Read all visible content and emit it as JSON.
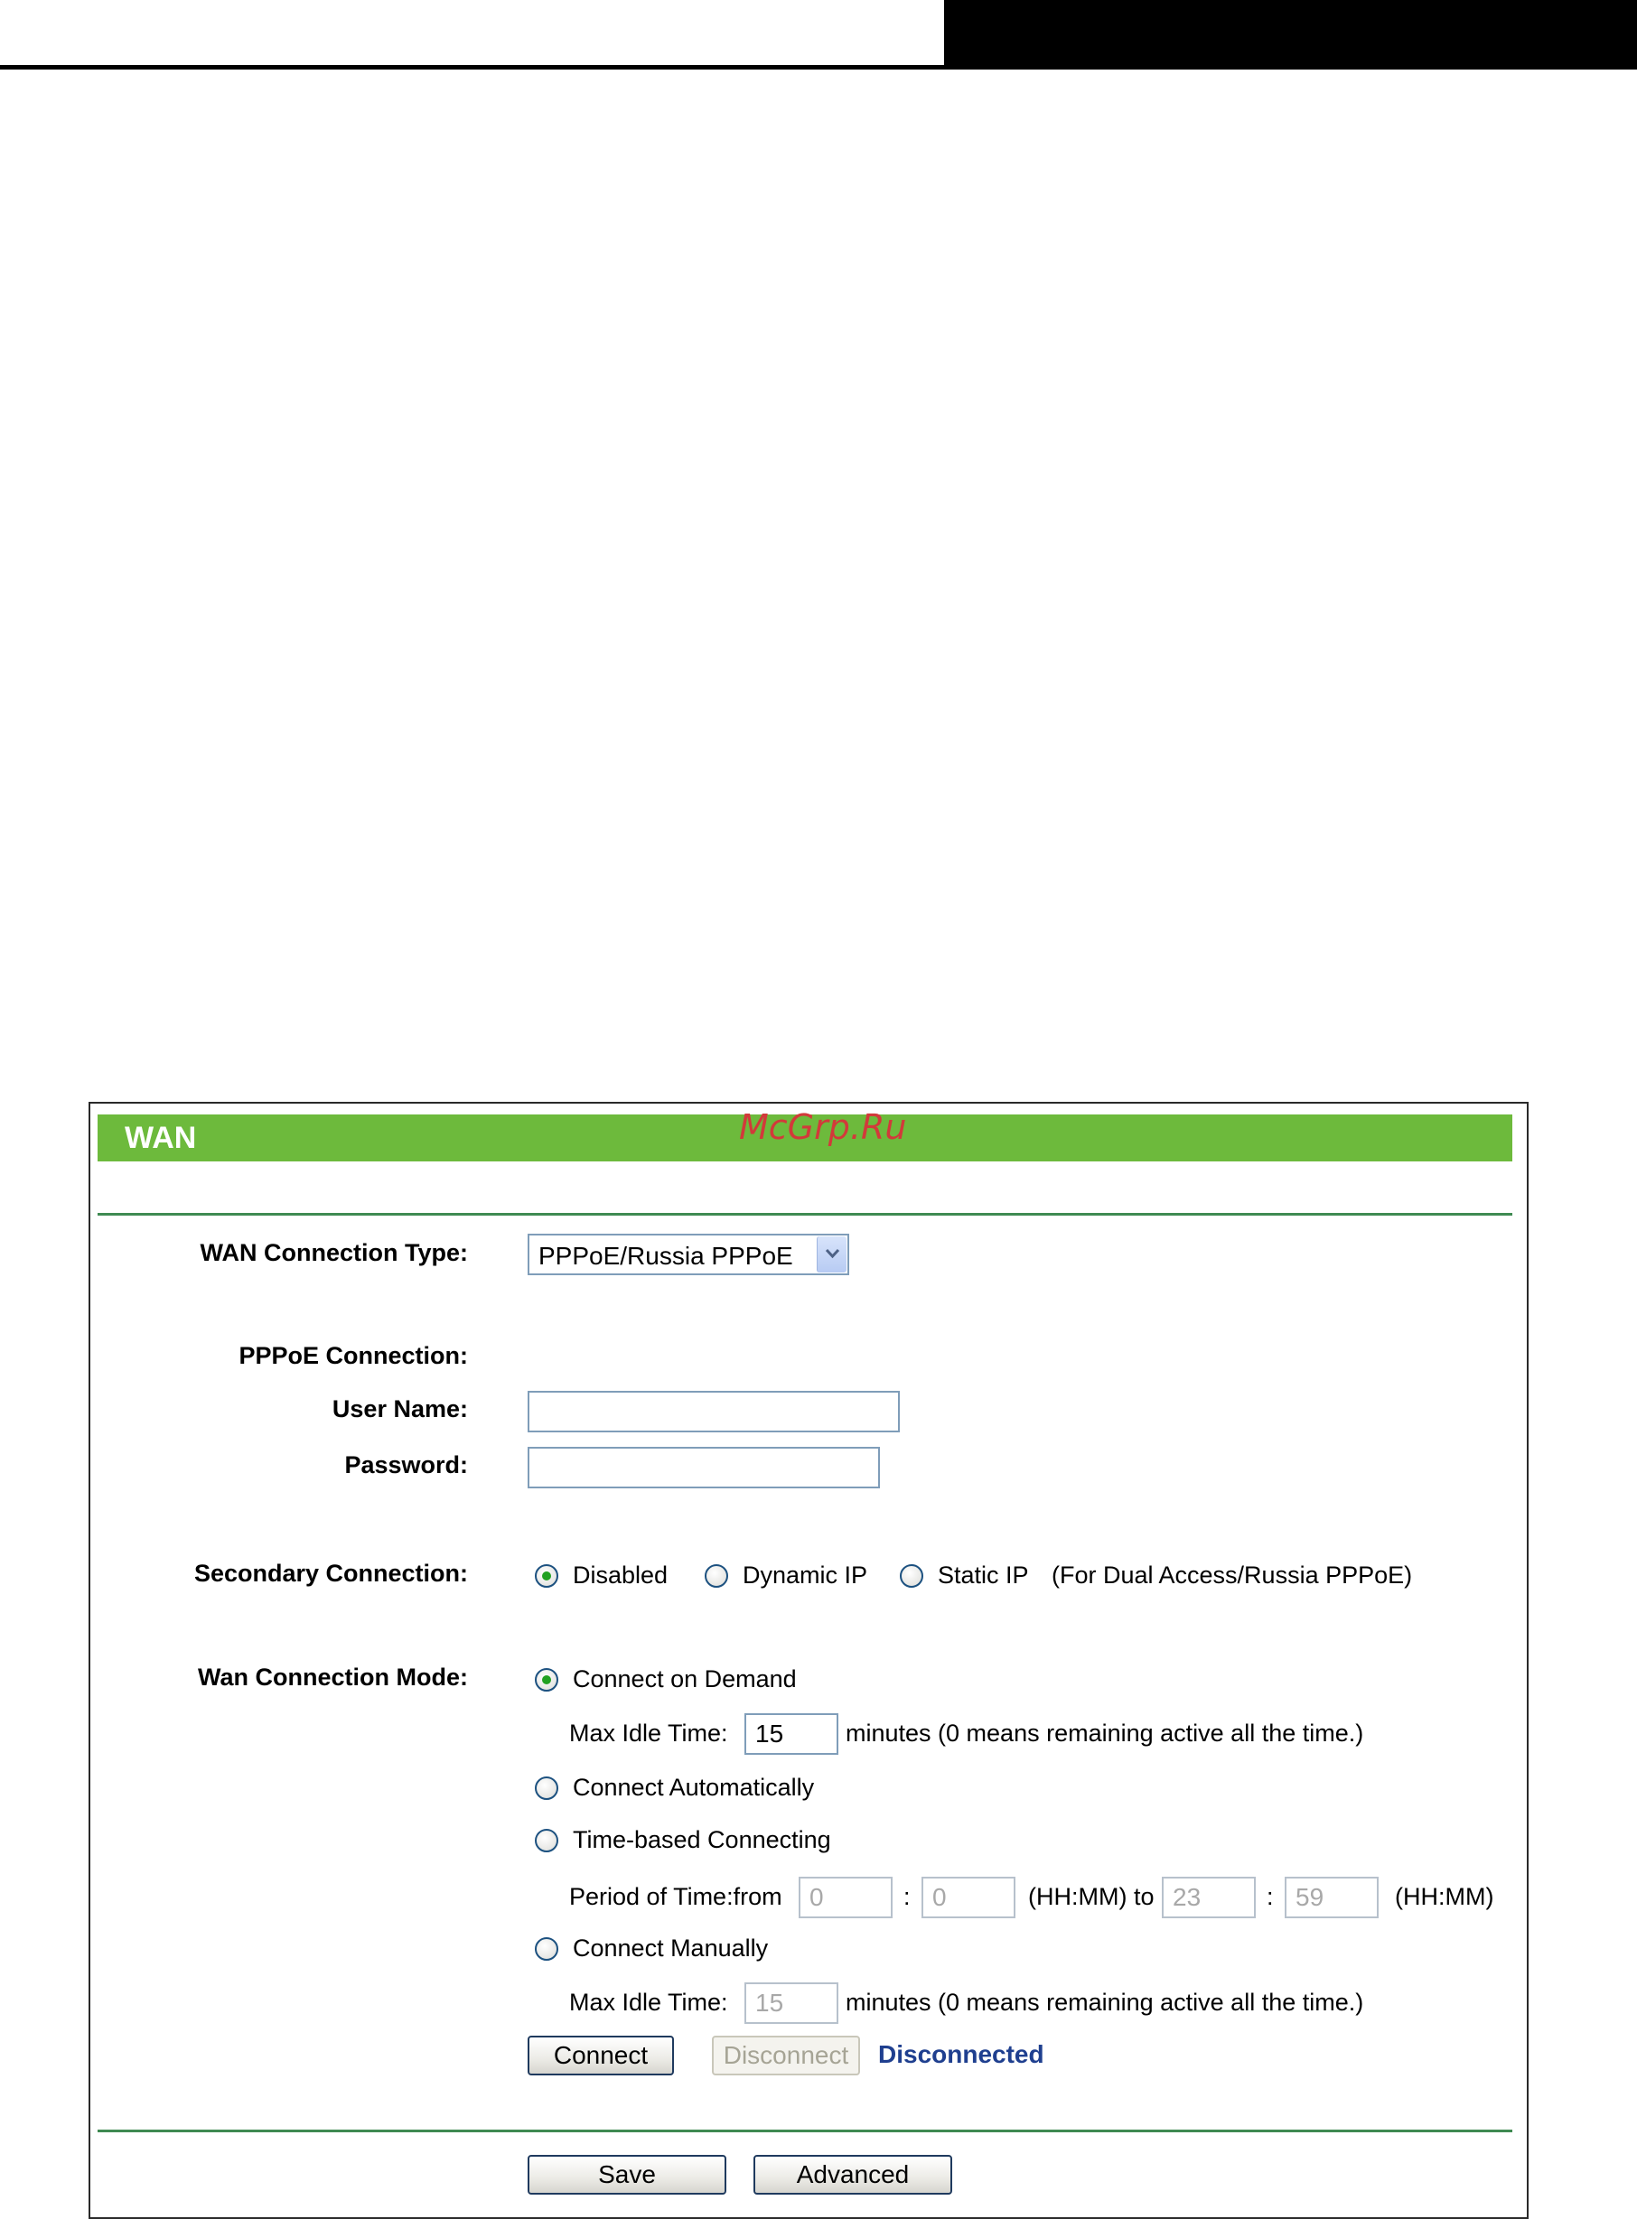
{
  "panel": {
    "title": "WAN",
    "watermark": "McGrp.Ru"
  },
  "form": {
    "wan_connection_type": {
      "label": "WAN Connection Type:",
      "value": "PPPoE/Russia PPPoE"
    },
    "pppoe_connection": {
      "label": "PPPoE Connection:"
    },
    "user_name": {
      "label": "User Name:",
      "value": ""
    },
    "password": {
      "label": "Password:",
      "value": ""
    },
    "secondary_connection": {
      "label": "Secondary Connection:",
      "options": [
        "Disabled",
        "Dynamic IP",
        "Static IP"
      ],
      "selected": "Disabled",
      "note": "(For Dual Access/Russia PPPoE)"
    },
    "wan_connection_mode": {
      "label": "Wan Connection Mode:",
      "selected": "Connect on Demand",
      "connect_on_demand": {
        "label": "Connect on Demand",
        "max_idle_label": "Max Idle Time:",
        "max_idle_value": "15",
        "max_idle_note": "minutes (0 means remaining active all the time.)"
      },
      "connect_automatically": {
        "label": "Connect Automatically"
      },
      "time_based": {
        "label": "Time-based Connecting",
        "period_label": "Period of Time:from",
        "from_hh": "0",
        "from_mm": "0",
        "colon": ":",
        "to_label": "(HH:MM) to",
        "to_hh": "23",
        "to_mm": "59",
        "end_label": "(HH:MM)"
      },
      "connect_manually": {
        "label": "Connect Manually",
        "max_idle_label": "Max Idle Time:",
        "max_idle_value": "15",
        "max_idle_note": "minutes (0 means remaining active all the time.)"
      }
    },
    "connect_button": "Connect",
    "disconnect_button": "Disconnect",
    "status": "Disconnected"
  },
  "footer": {
    "save_button": "Save",
    "advanced_button": "Advanced"
  },
  "colors": {
    "title_bar": "#6dba3c",
    "rule": "#3f8a52",
    "status": "#1f3f8f",
    "watermark": "#d23a3a"
  }
}
